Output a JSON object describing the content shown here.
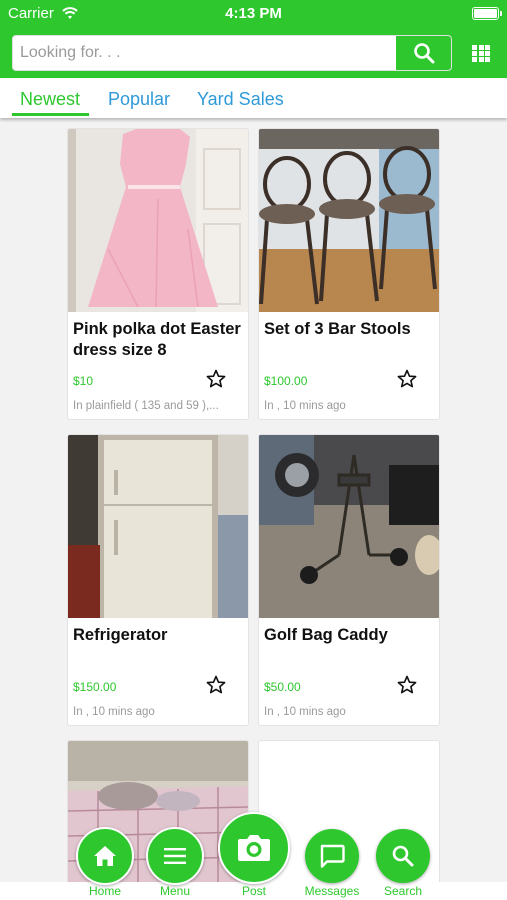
{
  "status_bar": {
    "carrier": "Carrier",
    "time": "4:13 PM"
  },
  "search": {
    "placeholder": "Looking for. . ."
  },
  "tabs": [
    {
      "label": "Newest",
      "active": true
    },
    {
      "label": "Popular",
      "active": false
    },
    {
      "label": "Yard Sales",
      "active": false
    }
  ],
  "listings": [
    {
      "title": "Pink polka dot Easter dress size 8",
      "price": "$10",
      "location": "In plainfield ( 135 and 59 ),..."
    },
    {
      "title": "Set of 3 Bar Stools",
      "price": "$100.00",
      "location": "In , 10 mins ago"
    },
    {
      "title": "Refrigerator",
      "price": "$150.00",
      "location": "In , 10 mins ago"
    },
    {
      "title": "Golf Bag Caddy",
      "price": "$50.00",
      "location": "In , 10 mins ago"
    }
  ],
  "bottom_nav": [
    {
      "label": "Home",
      "icon": "home-icon"
    },
    {
      "label": "Menu",
      "icon": "menu-icon"
    },
    {
      "label": "Post",
      "icon": "camera-icon"
    },
    {
      "label": "Messages",
      "icon": "chat-icon"
    },
    {
      "label": "Search",
      "icon": "search-icon"
    }
  ],
  "colors": {
    "brand_green": "#2ec82e",
    "tab_blue": "#2f9ad9",
    "muted_text": "#9a9a9a"
  }
}
